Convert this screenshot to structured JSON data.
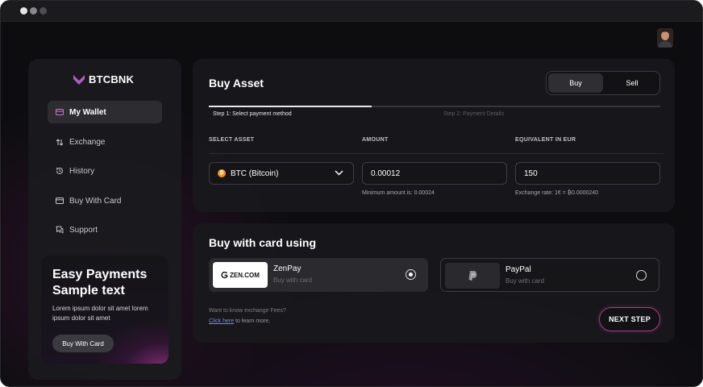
{
  "brand": {
    "name": "BTCBNK",
    "accent": "#a33d86",
    "logo_color": "#b25cc7"
  },
  "header": {
    "avatar_icon": "user-avatar"
  },
  "sidebar": {
    "items": [
      {
        "label": "My Wallet",
        "icon": "wallet-icon",
        "active": true
      },
      {
        "label": "Exchange",
        "icon": "exchange-arrows-icon",
        "active": false
      },
      {
        "label": "History",
        "icon": "history-icon",
        "active": false
      },
      {
        "label": "Buy With Card",
        "icon": "card-icon",
        "active": false
      },
      {
        "label": "Support",
        "icon": "chat-icon",
        "active": false
      }
    ],
    "promo": {
      "title": "Easy Payments Sample text",
      "text": "Lorem ipsum dolor sit amet lorem ipsum dolor sit amet",
      "button": "Buy With Card"
    }
  },
  "buy_asset": {
    "title": "Buy Asset",
    "toggle": {
      "buy": "Buy",
      "sell": "Sell",
      "selected": "Buy"
    },
    "steps": [
      {
        "label": "Step 1: Select payment method",
        "active": true
      },
      {
        "label": "Step 2: Payment Details",
        "active": false
      }
    ],
    "progress": 0.36,
    "columns": {
      "asset": "SELECT ASSET",
      "amount": "AMOUNT",
      "eur": "EQUIVALENT IN EUR"
    },
    "asset_value": "BTC (Bitcoin)",
    "amount_value": "0.00012",
    "eur_value": "150",
    "min_amount_hint": "Minimum amount is: 0.00024",
    "rate_hint": "Exchange rate: 1€ = ₿0.0000240"
  },
  "card_payment": {
    "title": "Buy with card using",
    "methods": [
      {
        "name": "ZenPay",
        "sub": "Buy with card",
        "logo_text": "ZEN.COM",
        "selected": true
      },
      {
        "name": "PayPal",
        "sub": "Buy with card",
        "logo_text": "",
        "selected": false
      }
    ],
    "fees_question": "Want to know exchange Fees?",
    "fees_link": "Click here",
    "fees_suffix": " to learn more.",
    "next_button": "NEXT STEP"
  }
}
